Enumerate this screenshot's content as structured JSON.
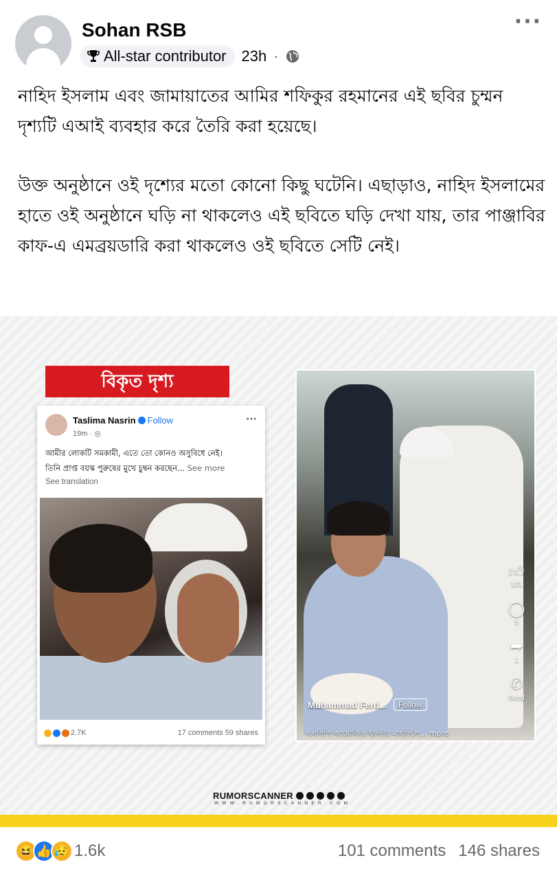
{
  "post": {
    "author": "Sohan RSB",
    "badge": "All-star contributor",
    "time": "23h",
    "separator": "·",
    "more_icon": "···",
    "paragraphs": [
      "নাহিদ ইসলাম এবং জামায়াতের আমির শফিকুর রহমানের এই ছবির চুম্মন দৃশ্যটি এআই ব্যবহার করে তৈরি করা হয়েছে।",
      "উক্ত অনুষ্ঠানে ওই দৃশ্যের মতো কোনো কিছু ঘটেনি। এছাড়াও, নাহিদ ইসলামের হাতে ওই অনুষ্ঠানে ঘড়ি না থাকলেও এই ছবিতে ঘড়ি দেখা যায়, তার পাঞ্জাবির কাফ-এ এমব্রয়ডারি করা থাকলেও ওই ছবিতে সেটি নেই।"
    ]
  },
  "image": {
    "label": "বিকৃত দৃশ্য",
    "label_color": "#d71920",
    "fb_card": {
      "name": "Taslima Nasrin",
      "follow": "Follow",
      "time": "19m · ",
      "dots": "···",
      "text_line1": "আমীর লোকটি সমকামী, এতে তো কোনও অসুবিধে নেই।",
      "text_line2": "তিনি প্রাপ্ত বয়স্ক পুরুষের মুখে চুম্বন করছেন...",
      "see_more": " See more",
      "see_translation": "See translation",
      "reactions_count": "2.7K",
      "comments": "17 comments",
      "shares": "59 shares"
    },
    "reel": {
      "like_count": "101",
      "comment_count": "5",
      "share_count": "1",
      "send_label": "Send",
      "author": "Muhammad Ferd...",
      "follow": "Follow",
      "caption": "এনসিপি আয়োজিত ইফতার মাহফিলে... more"
    },
    "brand": "RUMORSCANNER",
    "brand_url": "WWW.RUMORSCANNER.COM",
    "accent_bar_color": "#f7d21c"
  },
  "footer": {
    "reaction_count": "1.6k",
    "comments": "101 comments",
    "shares": "146 shares"
  }
}
